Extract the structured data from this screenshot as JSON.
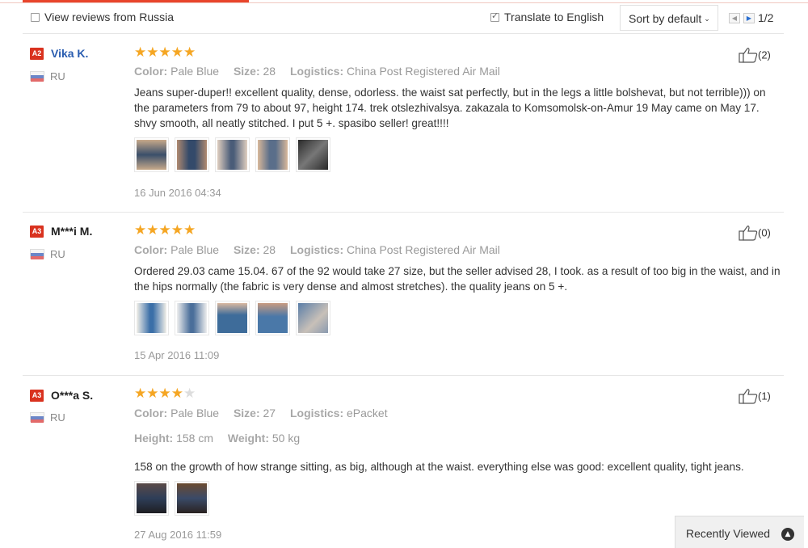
{
  "toolbar": {
    "view_russia_label": "View reviews from Russia",
    "view_russia_checked": false,
    "translate_label": "Translate to English",
    "translate_checked": true,
    "sort_label": "Sort by default",
    "page_label": "1/2"
  },
  "reviews": [
    {
      "badge": "A2",
      "name": "Vika K.",
      "country": "RU",
      "rating": 5,
      "attrs": [
        {
          "key": "Color:",
          "value": "Pale Blue"
        },
        {
          "key": "Size:",
          "value": "28"
        },
        {
          "key": "Logistics:",
          "value": "China Post Registered Air Mail"
        }
      ],
      "text": "Jeans super-duper!! excellent quality, dense, odorless. the waist sat perfectly, but in the legs a little bolshevat, but not terrible))) on the parameters from 79 to about 97, height 174. trek otslezhivalsya. zakazala to Komsomolsk-on-Amur 19 May came on May 17. shvy smooth, all neatly stitched. I put 5 +. spasibo seller! great!!!!",
      "photos": 5,
      "date": "16 Jun 2016 04:34",
      "likes": "(2)"
    },
    {
      "badge": "A3",
      "name": "M***i M.",
      "country": "RU",
      "rating": 5,
      "attrs": [
        {
          "key": "Color:",
          "value": "Pale Blue"
        },
        {
          "key": "Size:",
          "value": "28"
        },
        {
          "key": "Logistics:",
          "value": "China Post Registered Air Mail"
        }
      ],
      "text": "Ordered 29.03 came 15.04. 67 of the 92 would take 27 size, but the seller advised 28, I took. as a result of too big in the waist, and in the hips normally (the fabric is very dense and almost stretches). the quality jeans on 5 +.",
      "photos": 5,
      "date": "15 Apr 2016 11:09",
      "likes": "(0)"
    },
    {
      "badge": "A3",
      "name": "O***a S.",
      "country": "RU",
      "rating": 4,
      "attrs": [
        {
          "key": "Color:",
          "value": "Pale Blue"
        },
        {
          "key": "Size:",
          "value": "27"
        },
        {
          "key": "Logistics:",
          "value": "ePacket"
        }
      ],
      "attrs2": [
        {
          "key": "Height:",
          "value": "158 cm"
        },
        {
          "key": "Weight:",
          "value": "50 kg"
        }
      ],
      "text": "158 on the growth of how strange sitting, as big, although at the waist. everything else was good: excellent quality, tight jeans.",
      "photos": 2,
      "date": "27 Aug 2016 11:59",
      "likes": "(1)"
    }
  ],
  "recently_viewed": "Recently Viewed",
  "colors": {
    "accent": "#e8452c",
    "badge": "#d9321f",
    "star": "#f5a623",
    "link": "#2a5db0"
  }
}
